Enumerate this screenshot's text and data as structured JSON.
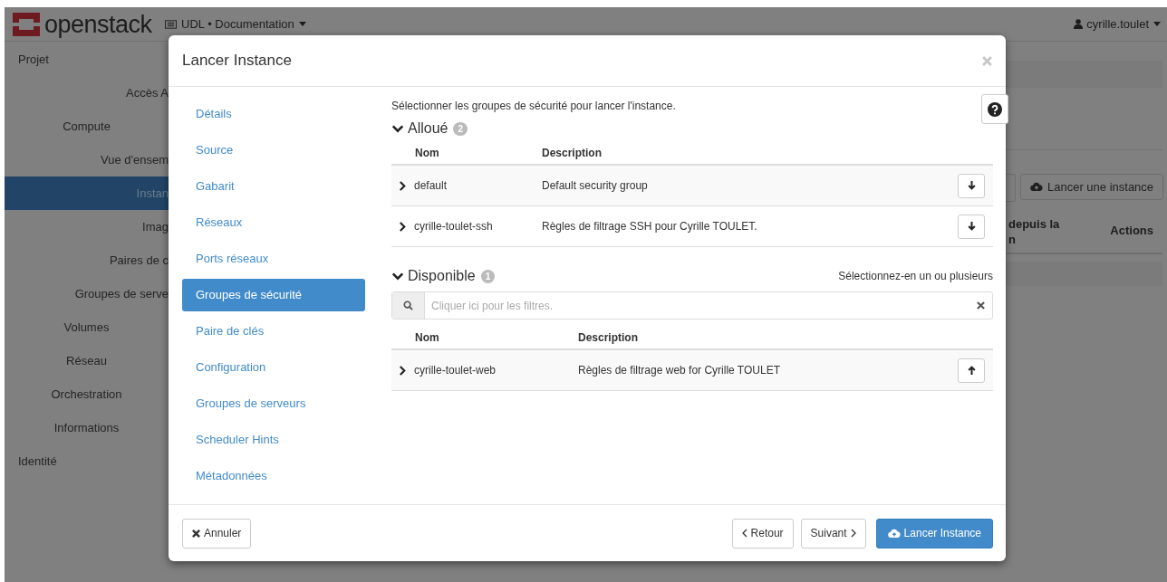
{
  "topbar": {
    "logo": "openstack",
    "project": "UDL • Documentation",
    "user": "cyrille.toulet"
  },
  "sidebar": {
    "items": [
      {
        "label": "Projet",
        "kind": "section",
        "children": [
          {
            "label": "Accès A",
            "kind": "link",
            "selected": false
          },
          {
            "label": "Compute",
            "kind": "group",
            "children": [
              {
                "label": "Vue d'ensem",
                "kind": "link",
                "selected": false
              },
              {
                "label": "Instan",
                "kind": "link",
                "selected": true
              },
              {
                "label": "Imag",
                "kind": "link",
                "selected": false
              },
              {
                "label": "Paires de c",
                "kind": "link",
                "selected": false
              },
              {
                "label": "Groupes de serve",
                "kind": "link",
                "selected": false
              }
            ]
          },
          {
            "label": "Volumes",
            "kind": "group"
          },
          {
            "label": "Réseau",
            "kind": "group"
          },
          {
            "label": "Orchestration",
            "kind": "group"
          },
          {
            "label": "Informations",
            "kind": "group"
          }
        ]
      },
      {
        "label": "Identité",
        "kind": "section"
      }
    ]
  },
  "background": {
    "launch_button": "Lancer une instance",
    "columns": [
      "depuis la n",
      "Actions"
    ]
  },
  "modal": {
    "title": "Lancer Instance",
    "steps": [
      {
        "label": "Détails",
        "selected": false
      },
      {
        "label": "Source",
        "selected": false
      },
      {
        "label": "Gabarit",
        "selected": false
      },
      {
        "label": "Réseaux",
        "selected": false
      },
      {
        "label": "Ports réseaux",
        "selected": false
      },
      {
        "label": "Groupes de sécurité",
        "selected": true
      },
      {
        "label": "Paire de clés",
        "selected": false
      },
      {
        "label": "Configuration",
        "selected": false
      },
      {
        "label": "Groupes de serveurs",
        "selected": false
      },
      {
        "label": "Scheduler Hints",
        "selected": false
      },
      {
        "label": "Métadonnées",
        "selected": false
      }
    ],
    "intro": "Sélectionner les groupes de sécurité pour lancer l'instance.",
    "allocated": {
      "title": "Alloué",
      "count": "2",
      "expanded": true,
      "columns": [
        "Nom",
        "Description"
      ],
      "rows": [
        {
          "name": "default",
          "description": "Default security group"
        },
        {
          "name": "cyrille-toulet-ssh",
          "description": "Règles de filtrage SSH pour Cyrille TOULET."
        }
      ]
    },
    "available": {
      "title": "Disponible",
      "count": "1",
      "expanded": true,
      "hint": "Sélectionnez-en un ou plusieurs",
      "filter": {
        "placeholder": "Cliquer ici pour les filtres."
      },
      "columns": [
        "Nom",
        "Description"
      ],
      "rows": [
        {
          "name": "cyrille-toulet-web",
          "description": "Règles de filtrage web for Cyrille TOULET"
        }
      ]
    },
    "footer": {
      "cancel": "Annuler",
      "back": "Retour",
      "next": "Suivant",
      "launch": "Lancer Instance"
    }
  }
}
